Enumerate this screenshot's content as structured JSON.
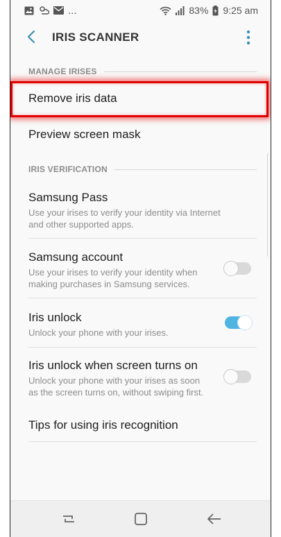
{
  "status_bar": {
    "icons_left": [
      "gallery-icon",
      "weather-icon",
      "mail-icon"
    ],
    "more_notifications": "...",
    "battery": "83%",
    "time": "9:25 am",
    "icons_right": [
      "wifi-icon",
      "signal-icon",
      "battery-icon"
    ]
  },
  "app_bar": {
    "title": "IRIS SCANNER",
    "back_icon": "back-arrow-icon",
    "more_icon": "more-options-icon",
    "accent": "#3a8fb7"
  },
  "sections": {
    "manage": "MANAGE IRISES",
    "verification": "IRIS VERIFICATION"
  },
  "items": {
    "remove": {
      "title": "Remove iris data"
    },
    "preview": {
      "title": "Preview screen mask"
    },
    "pass": {
      "title": "Samsung Pass",
      "line1": "Use your irises to verify your identity via Internet",
      "line2": "and other supported apps."
    },
    "account": {
      "title": "Samsung account",
      "line1": "Use your irises to verify your identity when",
      "line2": "making purchases in Samsung services.",
      "toggle_on": false
    },
    "unlock": {
      "title": "Iris unlock",
      "line1": "Unlock your phone with your irises.",
      "toggle_on": true
    },
    "screen_on": {
      "title": "Iris unlock when screen turns on",
      "line1": "Unlock your phone with your irises as soon",
      "line2": "as the screen turns on, without swiping first.",
      "toggle_on": false
    },
    "tips": {
      "title": "Tips for using iris recognition"
    }
  },
  "colors": {
    "toggle_on": "#4fb4e2",
    "highlight": "#e00000"
  },
  "nav_bar": {
    "buttons": [
      "recent-apps-icon",
      "home-icon",
      "back-icon"
    ]
  }
}
